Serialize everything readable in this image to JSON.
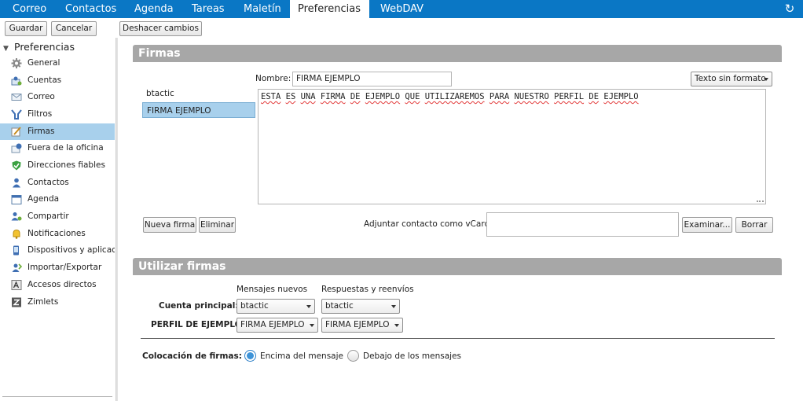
{
  "tabs": [
    "Correo",
    "Contactos",
    "Agenda",
    "Tareas",
    "Maletín",
    "Preferencias",
    "WebDAV"
  ],
  "active_tab": "Preferencias",
  "toolbar": {
    "save_label": "Guardar",
    "cancel_label": "Cancelar",
    "undo_label": "Deshacer cambios"
  },
  "sidebar": {
    "header": "Preferencias",
    "items": [
      {
        "label": "General",
        "icon": "gear-icon"
      },
      {
        "label": "Cuentas",
        "icon": "accounts-icon"
      },
      {
        "label": "Correo",
        "icon": "envelope-icon"
      },
      {
        "label": "Filtros",
        "icon": "filter-icon"
      },
      {
        "label": "Firmas",
        "icon": "signature-icon"
      },
      {
        "label": "Fuera de la oficina",
        "icon": "out-of-office-icon"
      },
      {
        "label": "Direcciones fiables",
        "icon": "shield-icon"
      },
      {
        "label": "Contactos",
        "icon": "contact-icon"
      },
      {
        "label": "Agenda",
        "icon": "calendar-icon"
      },
      {
        "label": "Compartir",
        "icon": "share-icon"
      },
      {
        "label": "Notificaciones",
        "icon": "bell-icon"
      },
      {
        "label": "Dispositivos y aplicaciones",
        "icon": "device-icon"
      },
      {
        "label": "Importar/Exportar",
        "icon": "import-export-icon"
      },
      {
        "label": "Accesos directos",
        "icon": "shortcut-icon"
      },
      {
        "label": "Zimlets",
        "icon": "zimlet-icon"
      }
    ],
    "selected": "Firmas"
  },
  "firmas": {
    "title": "Firmas",
    "signatures": [
      "btactic",
      "FIRMA EJEMPLO"
    ],
    "selected_signature": "FIRMA EJEMPLO",
    "name_label": "Nombre:",
    "name_value": "FIRMA EJEMPLO",
    "format_select": "Texto sin formato",
    "body_words": [
      "ESTA",
      "ES",
      "UNA",
      "FIRMA",
      "DE",
      "EJEMPLO",
      "QUE",
      "UTILIZAREMOS",
      "PARA",
      "NUESTRO",
      "PERFIL",
      "DE",
      "EJEMPLO"
    ],
    "new_button": "Nueva firma",
    "delete_button": "Eliminar",
    "vcard_label": "Adjuntar contacto como vCard:",
    "vcard_value": "",
    "browse_button": "Examinar...",
    "clear_button": "Borrar"
  },
  "usar": {
    "title": "Utilizar firmas",
    "col_new": "Mensajes nuevos",
    "col_reply": "Respuestas y reenvíos",
    "rows": [
      {
        "label": "Cuenta principal:",
        "new": "btactic",
        "reply": "btactic"
      },
      {
        "label": "PERFIL DE EJEMPLO:",
        "new": "FIRMA EJEMPLO",
        "reply": "FIRMA EJEMPLO"
      }
    ],
    "placement_label": "Colocación de firmas:",
    "placement_options": [
      "Encima del mensaje",
      "Debajo de los mensajes"
    ],
    "placement_selected": "Encima del mensaje"
  }
}
